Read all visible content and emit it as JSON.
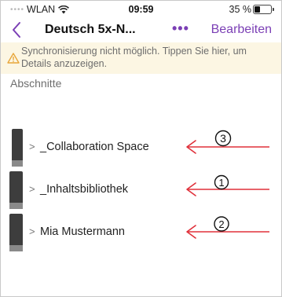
{
  "status_bar": {
    "carrier": "WLAN",
    "time": "09:59",
    "battery_pct_label": "35 %",
    "battery_level": 0.35
  },
  "nav": {
    "title": "Deutsch 5x-N...",
    "more_label": "•••",
    "edit_label": "Bearbeiten"
  },
  "sync_banner": {
    "text": "Synchronisierung nicht möglich. Tippen Sie hier, um Details anzuzeigen."
  },
  "sections_heading": "Abschnitte",
  "sections": [
    {
      "label": "_Collaboration Space",
      "annotation": "3"
    },
    {
      "label": "_Inhaltsbibliothek",
      "annotation": "1"
    },
    {
      "label": "Mia Mustermann",
      "annotation": "2"
    }
  ],
  "colors": {
    "accent": "#7b3fb5",
    "banner_bg": "#fcf6e3",
    "warning": "#e8a63a",
    "annotation": "#e0303a"
  },
  "icons": [
    "wifi-icon",
    "battery-icon",
    "back-chevron-icon",
    "warning-icon",
    "chevron-right-icon",
    "red-arrow-annotation"
  ]
}
